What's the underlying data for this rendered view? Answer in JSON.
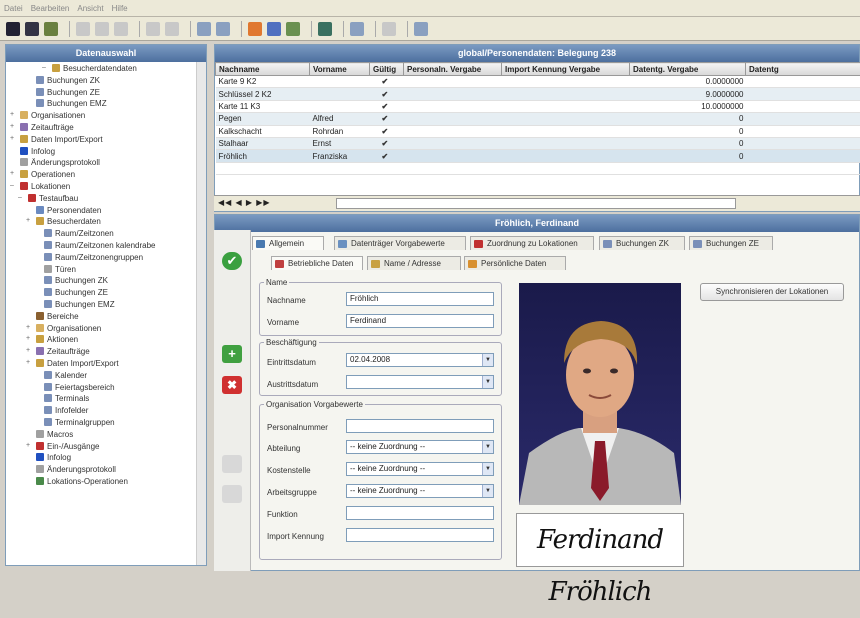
{
  "menu": [
    "Datei",
    "Bearbeiten",
    "Ansicht",
    "Hilfe"
  ],
  "left_title": "Datenauswahl",
  "tree": [
    {
      "label": "Besucherdatendaten",
      "color": "#c8a040"
    },
    {
      "label": "Buchungen ZK",
      "color": "#7a8fb8"
    },
    {
      "label": "Buchungen ZE",
      "color": "#7a8fb8"
    },
    {
      "label": "Buchungen EMZ",
      "color": "#7a8fb8"
    },
    {
      "label": "Organisationen",
      "color": "#d8b060"
    },
    {
      "label": "Zeitaufträge",
      "color": "#8a70b0"
    },
    {
      "label": "Daten Import/Export",
      "color": "#c8a040"
    },
    {
      "label": "Infolog",
      "color": "#2050c0"
    },
    {
      "label": "Änderungsprotokoll",
      "color": "#a0a0a0"
    },
    {
      "label": "Operationen",
      "color": "#c8a040"
    },
    {
      "label": "Lokationen",
      "color": "#c03030"
    },
    {
      "label": "Testaufbau",
      "color": "#c03030"
    },
    {
      "label": "Personendaten",
      "color": "#6a8ac0"
    },
    {
      "label": "Besucherdaten",
      "color": "#c8a040"
    },
    {
      "label": "Raum/Zeitzonen",
      "color": "#7a8fb8"
    },
    {
      "label": "Raum/Zeitzonen kalendrabe",
      "color": "#7a8fb8"
    },
    {
      "label": "Raum/Zeitzonengruppen",
      "color": "#7a8fb8"
    },
    {
      "label": "Türen",
      "color": "#a0a0a0"
    },
    {
      "label": "Buchungen ZK",
      "color": "#7a8fb8"
    },
    {
      "label": "Buchungen ZE",
      "color": "#7a8fb8"
    },
    {
      "label": "Buchungen EMZ",
      "color": "#7a8fb8"
    },
    {
      "label": "Bereiche",
      "color": "#8a6030"
    },
    {
      "label": "Organisationen",
      "color": "#d8b060"
    },
    {
      "label": "Aktionen",
      "color": "#c8a040"
    },
    {
      "label": "Zeitaufträge",
      "color": "#8a70b0"
    },
    {
      "label": "Daten Import/Export",
      "color": "#c8a040"
    },
    {
      "label": "Kalender",
      "color": "#7a8fb8"
    },
    {
      "label": "Feiertagsbereich",
      "color": "#7a8fb8"
    },
    {
      "label": "Terminals",
      "color": "#7a8fb8"
    },
    {
      "label": "Infofelder",
      "color": "#7a8fb8"
    },
    {
      "label": "Terminalgruppen",
      "color": "#7a8fb8"
    },
    {
      "label": "Macros",
      "color": "#a0a0a0"
    },
    {
      "label": "Ein-/Ausgänge",
      "color": "#c03030"
    },
    {
      "label": "Infolog",
      "color": "#2050c0"
    },
    {
      "label": "Änderungsprotokoll",
      "color": "#a0a0a0"
    },
    {
      "label": "Lokations-Operationen",
      "color": "#4a8a4a"
    }
  ],
  "grid_title": "global/Personendaten: Belegung 238",
  "grid_headers": [
    "Nachname",
    "Vorname",
    "Gültig",
    "Personaln. Vergabe",
    "Import Kennung Vergabe",
    "Datentg. Vergabe",
    "Datentg"
  ],
  "grid_rows": [
    [
      "Karte 9 K2",
      "",
      "✔",
      "",
      "",
      "0.0000000"
    ],
    [
      "Schlüssel 2 K2",
      "",
      "✔",
      "",
      "",
      "9.0000000"
    ],
    [
      "Karte 11 K3",
      "",
      "✔",
      "",
      "",
      "10.0000000"
    ],
    [
      "Pegen",
      "Alfred",
      "✔",
      "",
      "",
      "0"
    ],
    [
      "Kalkschacht",
      "Rohrdan",
      "✔",
      "",
      "",
      "0"
    ],
    [
      "Stalhaar",
      "Ernst",
      "✔",
      "",
      "",
      "0"
    ],
    [
      "Fröhlich",
      "Franziska",
      "✔",
      "",
      "",
      "0"
    ]
  ],
  "detail_title": "Fröhlich, Ferdinand",
  "tabs_row1": [
    "Allgemein",
    "Datenträger Vorgabewerte",
    "Zuordnung zu Lokationen",
    "Buchungen ZK",
    "Buchungen ZE"
  ],
  "tabs_row2": [
    "Betriebliche Daten",
    "Name / Adresse",
    "Persönliche Daten"
  ],
  "name_group": {
    "legend": "Name",
    "nachname_label": "Nachname",
    "nachname": "Fröhlich",
    "vorname_label": "Vorname",
    "vorname": "Ferdinand"
  },
  "beschaeftigung": {
    "legend": "Beschäftigung",
    "eintritt_label": "Eintrittsdatum",
    "eintritt": "02.04.2008",
    "austritt_label": "Austrittsdatum",
    "austritt": ""
  },
  "organisation": {
    "legend": "Organisation Vorgabewerte",
    "personalnummer_label": "Personalnummer",
    "personalnummer": "",
    "abteilung_label": "Abteilung",
    "abteilung": "-- keine Zuordnung --",
    "kostenstelle_label": "Kostenstelle",
    "kostenstelle": "-- keine Zuordnung --",
    "arbeitsgruppe_label": "Arbeitsgruppe",
    "arbeitsgruppe": "-- keine Zuordnung --",
    "funktion_label": "Funktion",
    "funktion": "",
    "import_label": "Import Kennung",
    "import": ""
  },
  "sync_button": "Synchronisieren der Lokationen",
  "signature": "Ferdinand Fröhlich"
}
